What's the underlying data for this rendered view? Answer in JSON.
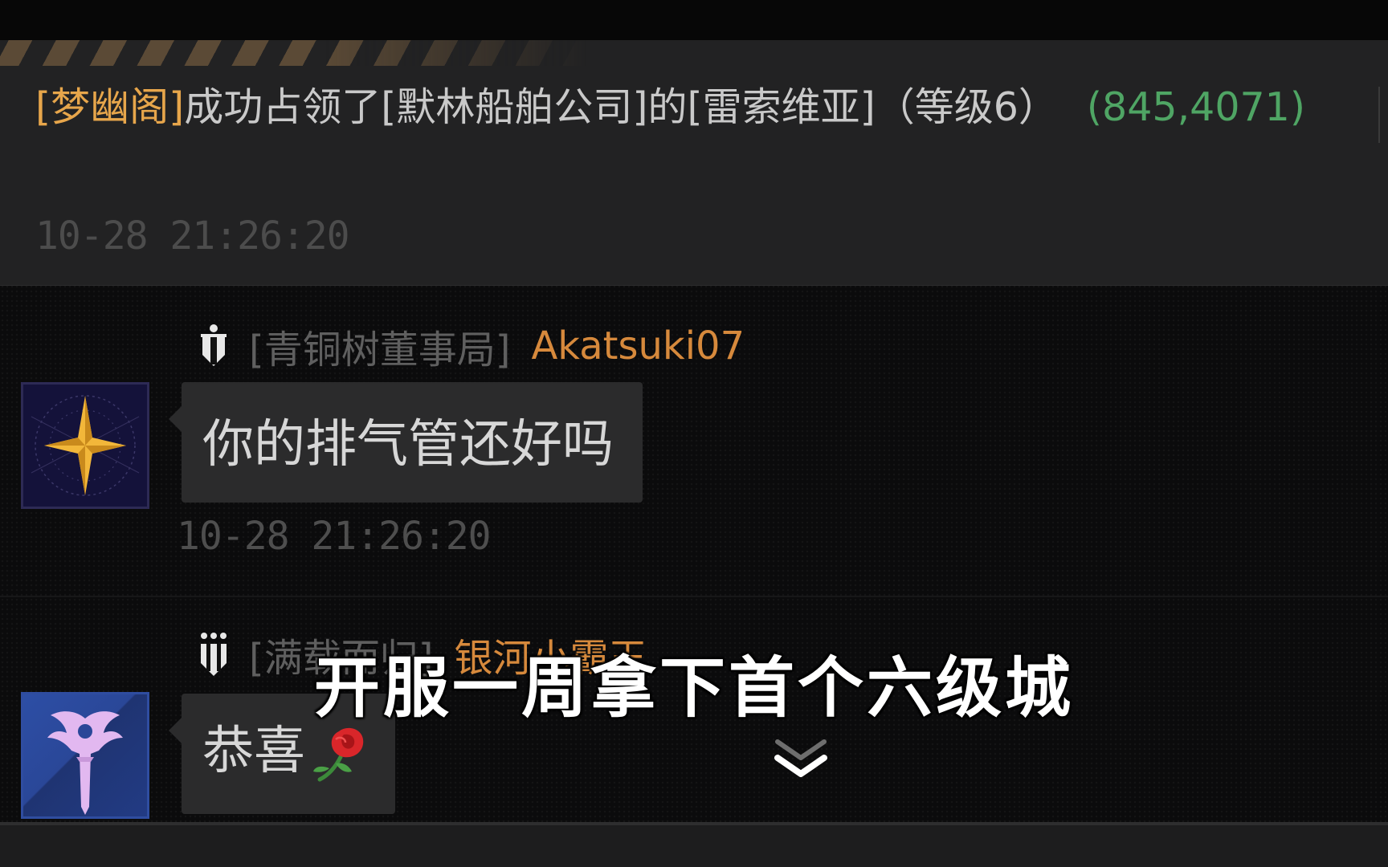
{
  "announcement": {
    "alliance": "[梦幽阁]",
    "text_before_company": "成功占领了",
    "company": "[默林船舶公司]",
    "text_of": "的",
    "city": "[雷索维亚]",
    "level": "（等级6）",
    "coords": "(845,4071)",
    "timestamp": "10-28  21:26:20"
  },
  "messages": [
    {
      "alliance": "[青铜树董事局]",
      "username": "Akatsuki07",
      "text": "你的排气管还好吗",
      "timestamp": "10-28  21:26:20",
      "avatar_icon": "compass-star-icon"
    },
    {
      "alliance": "[满载而归]",
      "username": "银河小霸王",
      "text": "恭喜",
      "emoji": "rose-icon",
      "avatar_icon": "winged-sword-icon"
    }
  ],
  "subtitle": "开服一周拿下首个六级城",
  "colors": {
    "alliance_accent": "#e7a64b",
    "coords_green": "#4fa564",
    "username_orange": "#d6893c"
  }
}
